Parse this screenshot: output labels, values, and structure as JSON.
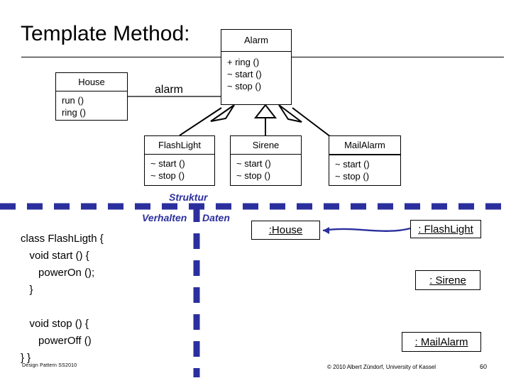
{
  "slide": {
    "title": "Template Method:",
    "page_number": "60",
    "footer_left": "Design Pattern SS2010",
    "footer_center": "© 2010 Albert Zündorf, University of Kassel",
    "accent_blue": "#2b2f9e",
    "line_black": "#000000"
  },
  "class_diagram": {
    "association_label": "alarm",
    "classes": [
      {
        "id": "alarm",
        "name": "Alarm",
        "operations": [
          "+ ring ()",
          "~ start ()",
          "~ stop ()"
        ]
      },
      {
        "id": "house",
        "name": "House",
        "operations": [
          "run ()",
          "ring ()"
        ]
      },
      {
        "id": "flashlight",
        "name": "FlashLight",
        "operations": [
          "~ start ()",
          "~ stop ()"
        ]
      },
      {
        "id": "sirene",
        "name": "Sirene",
        "operations": [
          "~ start ()",
          "~ stop ()"
        ]
      },
      {
        "id": "mailalarm",
        "name": "MailAlarm",
        "operations": [
          "~ start ()",
          "~ stop ()"
        ]
      }
    ]
  },
  "sections": {
    "struktur": "Struktur",
    "verhalten": "Verhalten",
    "daten": "Daten"
  },
  "code_block": "class FlashLigth {\n   void start () {\n      powerOn ();\n   }\n\n   void stop () {\n      powerOff ()\n} }",
  "object_diagram": {
    "objects": [
      {
        "id": "house",
        "label": ":House"
      },
      {
        "id": "flashlight",
        "label": ": FlashLight"
      },
      {
        "id": "sirene",
        "label": ": Sirene"
      },
      {
        "id": "mailalarm",
        "label": ": MailAlarm"
      }
    ]
  }
}
